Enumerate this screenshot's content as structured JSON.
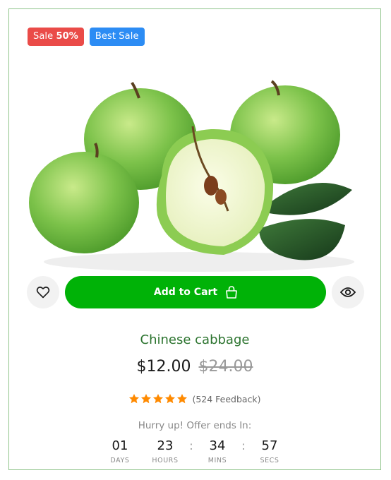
{
  "badges": {
    "sale_prefix": "Sale",
    "sale_value": "50%",
    "best": "Best Sale"
  },
  "product": {
    "name": "Chinese cabbage",
    "price_current": "$12.00",
    "price_original": "$24.00",
    "rating": 5,
    "feedback": "(524 Feedback)"
  },
  "actions": {
    "add_to_cart": "Add to Cart",
    "wishlist_icon": "heart-icon",
    "quick_view_icon": "eye-icon",
    "cart_icon": "bag-icon",
    "primary_color": "#00b207"
  },
  "countdown": {
    "label": "Hurry up! Offer ends In:",
    "units": [
      {
        "value": "01",
        "label": "DAYS"
      },
      {
        "value": "23",
        "label": "HOURS"
      },
      {
        "value": "34",
        "label": "MINS"
      },
      {
        "value": "57",
        "label": "SECS"
      }
    ],
    "separator": ":"
  },
  "colors": {
    "sale_badge": "#ea4b48",
    "best_badge": "#2c8cf4",
    "stars": "#ff8a00",
    "name": "#2c742f",
    "border": "#8fc48a"
  }
}
